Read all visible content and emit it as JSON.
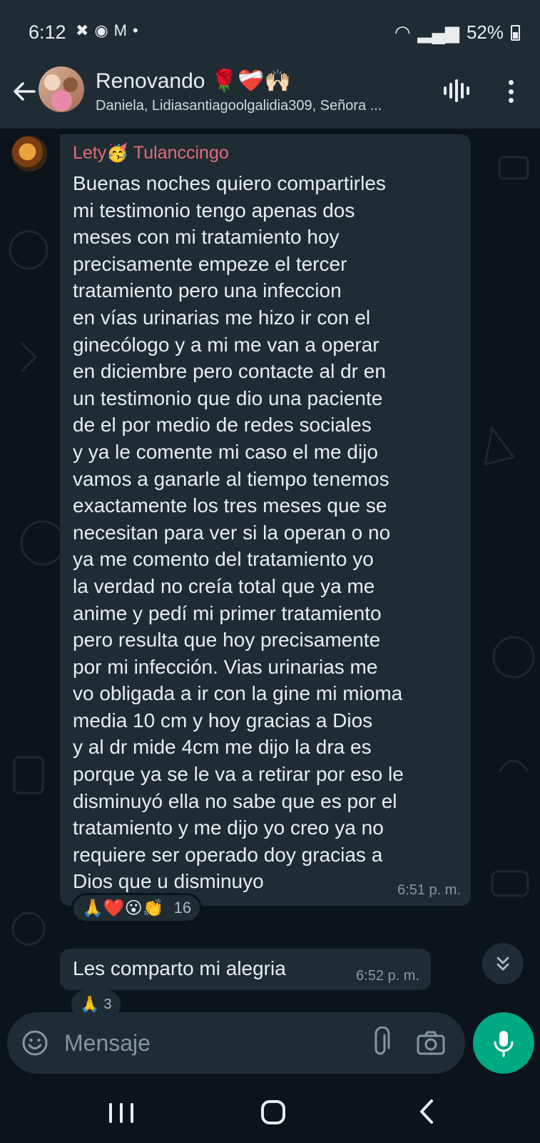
{
  "status_bar": {
    "time": "6:12",
    "battery": "52%"
  },
  "header": {
    "title": "Renovando 🌹❤️‍🩹🙌🏻",
    "subtitle": "Daniela, Lidiasantiagoolgalidia309, Señora ..."
  },
  "messages": [
    {
      "sender": "Lety🥳 Tulanccingo",
      "text": "Buenas noches quiero compartirles\nmi testimonio tengo apenas dos\nmeses con mi tratamiento hoy\nprecisamente empeze el tercer\ntratamiento pero una infeccion\nen vías urinarias me hizo ir con el\nginecólogo y a mi me van a operar\nen diciembre pero contacte al dr en\nun testimonio que dio una paciente\nde el por medio de redes sociales\ny ya le comente mi caso el me dijo\nvamos a ganarle al tiempo tenemos\nexactamente los tres meses que se\nnecesitan para ver si la operan o no\nya me comento del tratamiento yo\nla verdad no creía total que ya me\nanime y pedí mi primer tratamiento\npero resulta que hoy precisamente\npor mi infección. Vias urinarias me\nvo obligada a ir con la gine mi mioma\nmedia 10 cm y hoy gracias a Dios\ny al dr mide 4cm me dijo la dra es\nporque ya se le va a retirar por eso le\ndisminuyó ella no sabe que es por el\ntratamiento y me dijo yo creo ya no\nrequiere ser operado doy gracias a\nDios que u disminuyo",
      "time": "6:51 p. m.",
      "reactions": "🙏❤️😮👏",
      "reaction_count": "16"
    },
    {
      "text": "Les comparto  mi alegria",
      "time": "6:52 p. m.",
      "reactions": "🙏",
      "reaction_count": "3"
    }
  ],
  "input": {
    "placeholder": "Mensaje"
  },
  "icons": {
    "back": "arrow-left-icon",
    "voice_chat": "voice-chat-icon",
    "menu": "more-vertical-icon",
    "emoji": "emoji-icon",
    "attach": "paperclip-icon",
    "camera": "camera-icon",
    "mic": "microphone-icon",
    "scroll_down": "double-chevron-down-icon"
  },
  "colors": {
    "accent": "#00a884",
    "sender_name": "#e26b7a",
    "bubble": "#1f2c34",
    "background": "#0b141a"
  }
}
